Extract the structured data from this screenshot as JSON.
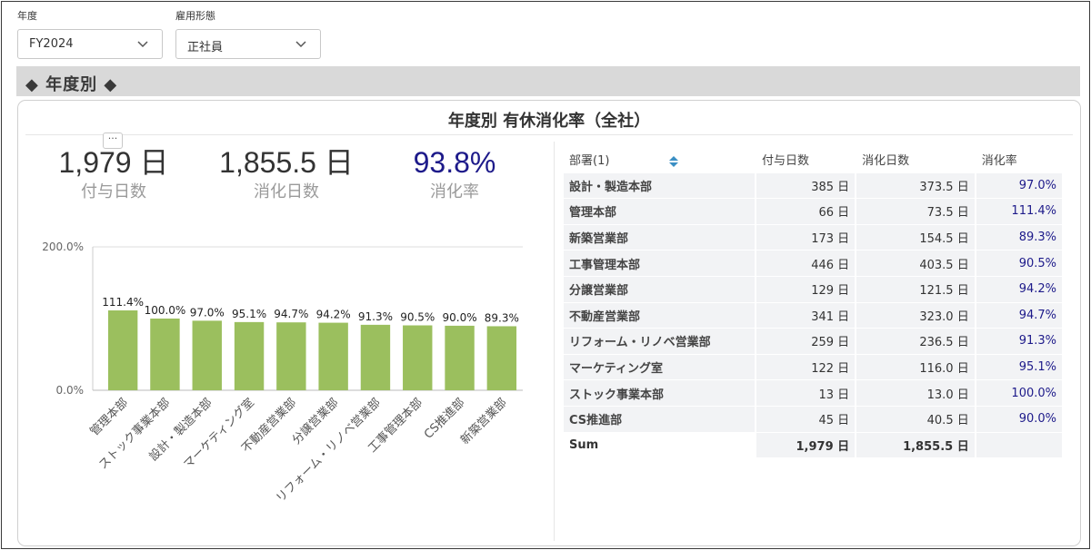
{
  "filters": [
    {
      "label": "年度",
      "value": "FY2024"
    },
    {
      "label": "雇用形態",
      "value": "正社員"
    }
  ],
  "section": {
    "title": "◆ 年度別 ◆"
  },
  "card": {
    "title": "年度別 有休消化率（全社）",
    "menu": "···"
  },
  "kpis": [
    {
      "value": "1,979 日",
      "label": "付与日数"
    },
    {
      "value": "1,855.5 日",
      "label": "消化日数"
    },
    {
      "value": "93.8%",
      "label": "消化率"
    }
  ],
  "chart_data": {
    "type": "bar",
    "categories": [
      "管理本部",
      "ストック事業本部",
      "設計・製造本部",
      "マーケティング室",
      "不動産営業部",
      "分譲営業部",
      "リフォーム・リノベ営業部",
      "工事管理本部",
      "CS推進部",
      "新築営業部"
    ],
    "values": [
      111.4,
      100.0,
      97.0,
      95.1,
      94.7,
      94.2,
      91.3,
      90.5,
      90.0,
      89.3
    ],
    "value_labels": [
      "111.4%",
      "100.0%",
      "97.0%",
      "95.1%",
      "94.7%",
      "94.2%",
      "91.3%",
      "90.5%",
      "90.0%",
      "89.3%"
    ],
    "ylim": [
      0,
      200
    ],
    "yticks": [
      "0.0%",
      "200.0%"
    ],
    "color": "#9bbf5e",
    "grid": true
  },
  "table": {
    "headers": {
      "dept": "部署(1)",
      "granted": "付与日数",
      "used": "消化日数",
      "rate": "消化率"
    },
    "rows": [
      {
        "dept": "設計・製造本部",
        "granted": "385 日",
        "used": "373.5 日",
        "rate": "97.0%"
      },
      {
        "dept": "管理本部",
        "granted": "66 日",
        "used": "73.5 日",
        "rate": "111.4%"
      },
      {
        "dept": "新築営業部",
        "granted": "173 日",
        "used": "154.5 日",
        "rate": "89.3%"
      },
      {
        "dept": "工事管理本部",
        "granted": "446 日",
        "used": "403.5 日",
        "rate": "90.5%"
      },
      {
        "dept": "分譲営業部",
        "granted": "129 日",
        "used": "121.5 日",
        "rate": "94.2%"
      },
      {
        "dept": "不動産営業部",
        "granted": "341 日",
        "used": "323.0 日",
        "rate": "94.7%"
      },
      {
        "dept": "リフォーム・リノベ営業部",
        "granted": "259 日",
        "used": "236.5 日",
        "rate": "91.3%"
      },
      {
        "dept": "マーケティング室",
        "granted": "122 日",
        "used": "116.0 日",
        "rate": "95.1%"
      },
      {
        "dept": "ストック事業本部",
        "granted": "13 日",
        "used": "13.0 日",
        "rate": "100.0%"
      },
      {
        "dept": "CS推進部",
        "granted": "45 日",
        "used": "40.5 日",
        "rate": "90.0%"
      }
    ],
    "sum": {
      "dept": "Sum",
      "granted": "1,979 日",
      "used": "1,855.5 日",
      "rate": ""
    }
  },
  "colors": {
    "accent": "#1d1a8a",
    "bar": "#9bbf5e",
    "section": "#d9d9d9"
  },
  "icons": {
    "filter": "chevron-down-icon",
    "sort": "sort-icon"
  }
}
